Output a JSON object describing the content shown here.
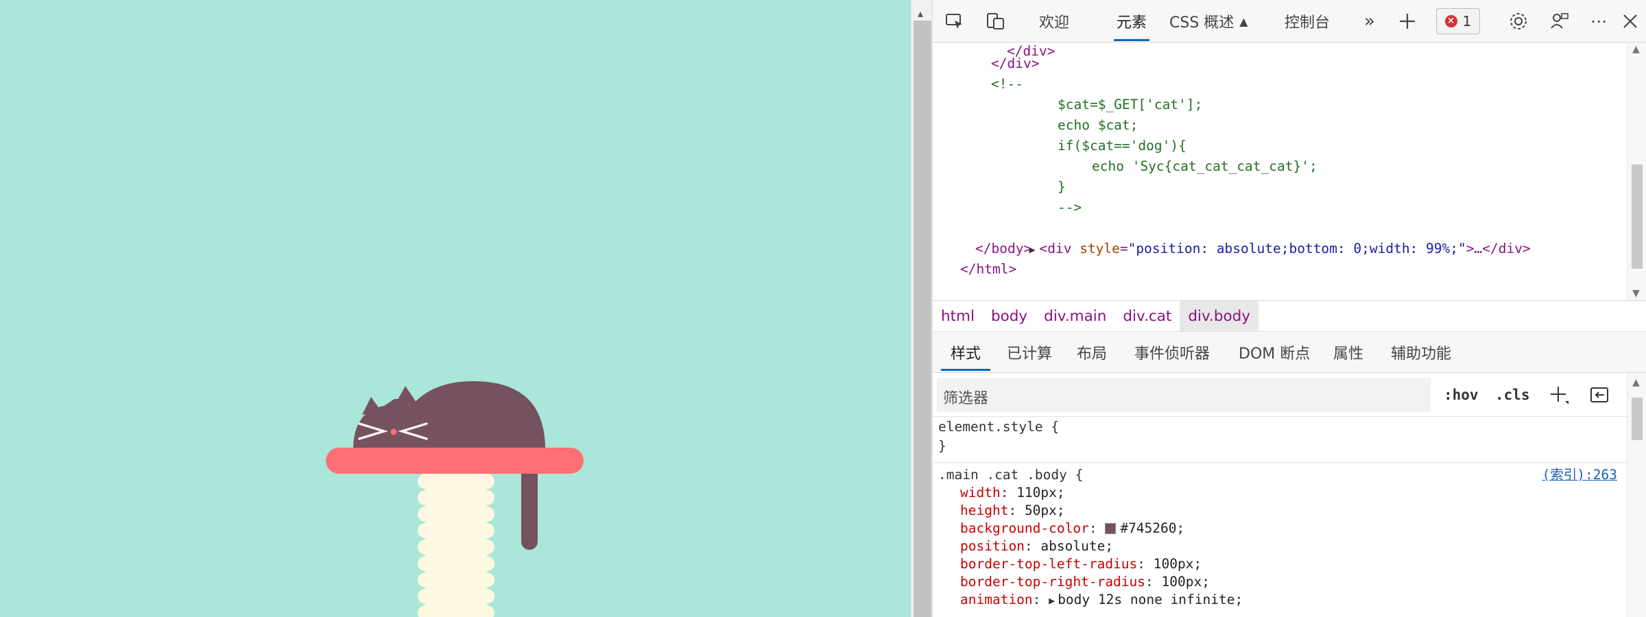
{
  "devtools": {
    "tabs": [
      "欢迎",
      "元素",
      "CSS 概述",
      "控制台"
    ],
    "active_tab": "元素",
    "error_count": "1",
    "icons": [
      "inspect-icon",
      "device-emulation-icon",
      "flask-icon",
      "more-tabs-icon",
      "add-tab-icon",
      "error-icon",
      "settings-icon",
      "feedback-icon",
      "more-options-icon",
      "close-icon"
    ]
  },
  "elements_code": {
    "line1": "</div>",
    "line2": "</div>",
    "line3": "<!--",
    "line4": "$cat=$_GET['cat'];",
    "line5": "echo $cat;",
    "line6": "if($cat=='dog'){",
    "line7": "echo 'Syc{cat_cat_cat_cat}';",
    "line8": "}",
    "line9": "-->",
    "line10_tag": "<div",
    "line10_attr": "style",
    "line10_val": "\"position: absolute;bottom: 0;width: 99%;\"",
    "line10_end": ">…</div>",
    "line11": "</body>",
    "line12": "</html>"
  },
  "breadcrumbs": [
    "html",
    "body",
    "div.main",
    "div.cat",
    "div.body"
  ],
  "subtabs": [
    "样式",
    "已计算",
    "布局",
    "事件侦听器",
    "DOM 断点",
    "属性",
    "辅助功能"
  ],
  "filter": {
    "placeholder": "筛选器",
    "hov": ":hov",
    "cls": ".cls"
  },
  "styles": {
    "element_style_selector": "element.style {",
    "element_style_close": "}",
    "rule_selector": ".main .cat .body {",
    "rule_source": "(索引):263",
    "declarations": [
      {
        "prop": "width",
        "value": "110px;"
      },
      {
        "prop": "height",
        "value": "50px;"
      },
      {
        "prop": "background-color",
        "value": "#745260;"
      },
      {
        "prop": "position",
        "value": "absolute;"
      },
      {
        "prop": "border-top-left-radius",
        "value": "100px;"
      },
      {
        "prop": "border-top-right-radius",
        "value": "100px;"
      },
      {
        "prop": "animation",
        "value": "body 12s none infinite;"
      }
    ]
  },
  "colors": {
    "page_background": "#abe6da",
    "cat": "#745260",
    "shelf": "#ff6f73",
    "post": "#fff8e1",
    "nose": "#ff6f73",
    "accent": "#0a66c2"
  }
}
